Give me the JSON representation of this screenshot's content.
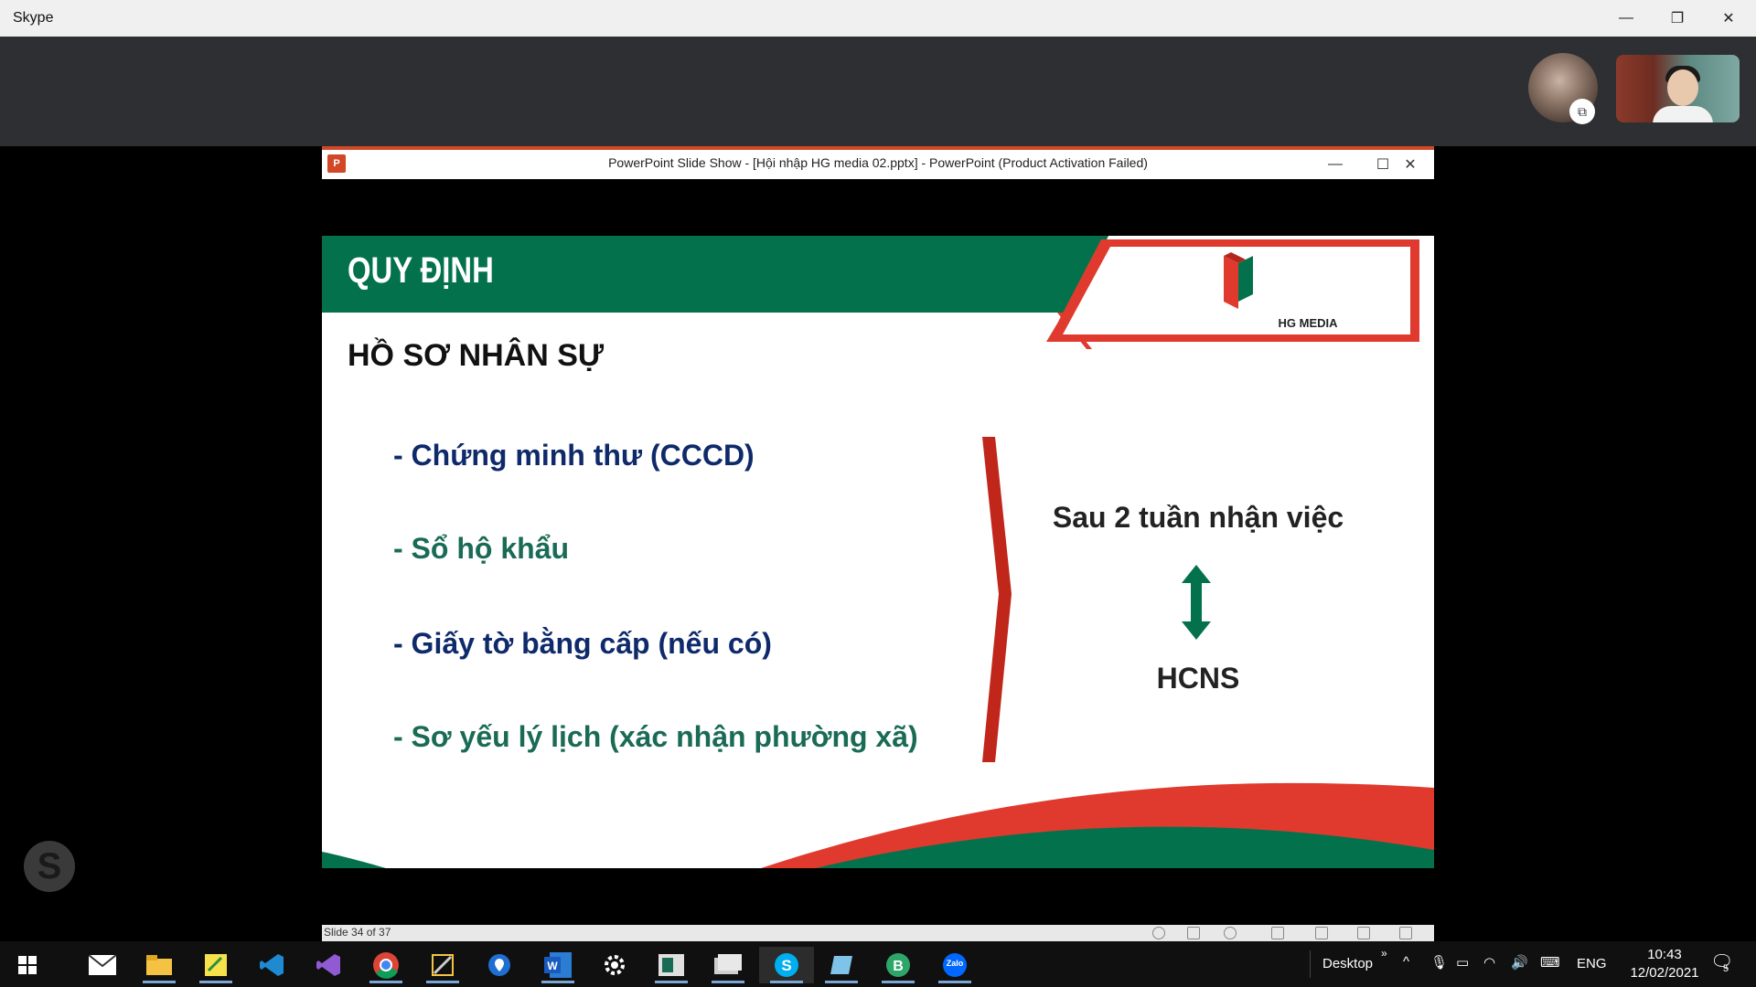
{
  "skype": {
    "title": "Skype",
    "minimize": "—",
    "restore": "❐",
    "close": "✕",
    "avatar_badge": "⧉"
  },
  "powerpoint": {
    "window_title": "PowerPoint Slide Show - [Hội nhập HG media 02.pptx] - PowerPoint (Product Activation Failed)",
    "logo": "P",
    "minimize": "—",
    "maximize": "☐",
    "close": "✕",
    "status_slide": "Slide 34 of 37"
  },
  "slide": {
    "header_title": "QUY ĐỊNH",
    "logo_text": "HG MEDIA",
    "section_title": "HỒ SƠ NHÂN SỰ",
    "items": [
      "- Chứng minh thư (CCCD)",
      "- Sổ hộ khẩu",
      "- Giấy tờ bằng cấp (nếu có)",
      "- Sơ yếu lý lịch (xác nhận phường xã)"
    ],
    "right_top": "Sau 2 tuần nhận việc",
    "right_bottom": "HCNS",
    "colors": {
      "green": "#03724c",
      "red": "#e03a2e",
      "bracket": "#c0261a"
    }
  },
  "taskbar": {
    "desktop_label": "Desktop",
    "language": "ENG",
    "time": "10:43",
    "date": "12/02/2021",
    "notification_count": "5",
    "apps": [
      "start-icon",
      "mail-icon",
      "file-explorer-icon",
      "sticky-app-icon",
      "vscode-icon",
      "visual-studio-icon",
      "chrome-icon",
      "snipping-tool-icon",
      "maps-icon",
      "word-icon",
      "settings-icon",
      "remote-app-icon",
      "photo-app-icon",
      "skype-icon",
      "notes-icon",
      "app-b-icon",
      "zalo-icon"
    ],
    "zalo_label": "Zalo"
  }
}
